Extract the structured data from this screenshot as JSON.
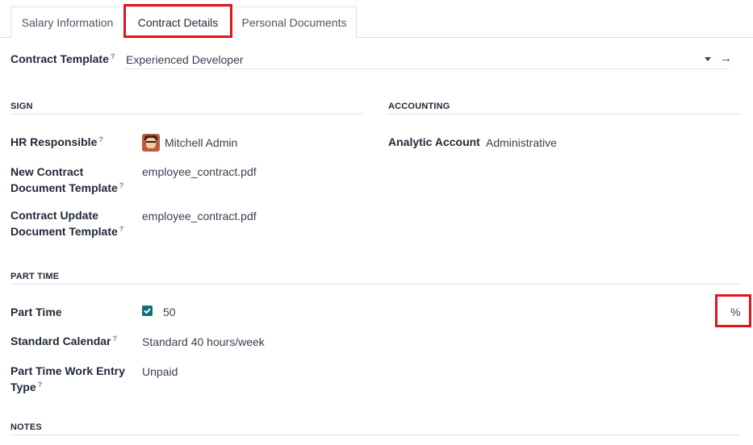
{
  "tabs": [
    {
      "label": "Salary Information"
    },
    {
      "label": "Contract Details"
    },
    {
      "label": "Personal Documents"
    }
  ],
  "contract_template": {
    "label": "Contract Template",
    "help": "?",
    "value": "Experienced Developer"
  },
  "sign": {
    "title": "SIGN",
    "hr_responsible": {
      "label": "HR Responsible",
      "help": "?",
      "value": "Mitchell Admin"
    },
    "new_contract": {
      "label_line1": "New Contract",
      "label_line2": "Document Template",
      "help": "?",
      "value": "employee_contract.pdf"
    },
    "contract_update": {
      "label_line1": "Contract Update",
      "label_line2": "Document Template",
      "help": "?",
      "value": "employee_contract.pdf"
    }
  },
  "accounting": {
    "title": "ACCOUNTING",
    "analytic_account": {
      "label": "Analytic Account",
      "value": "Administrative"
    }
  },
  "part_time": {
    "title": "PART TIME",
    "part_time": {
      "label": "Part Time",
      "checked": true,
      "value": "50",
      "unit": "%"
    },
    "standard_calendar": {
      "label": "Standard Calendar",
      "help": "?",
      "value": "Standard 40 hours/week"
    },
    "work_entry": {
      "label_line1": "Part Time Work Entry",
      "label_line2": "Type",
      "help": "?",
      "value": "Unpaid"
    }
  },
  "notes": {
    "title": "NOTES"
  },
  "colors": {
    "accent": "#0f6f78",
    "highlight": "#e3141c"
  }
}
